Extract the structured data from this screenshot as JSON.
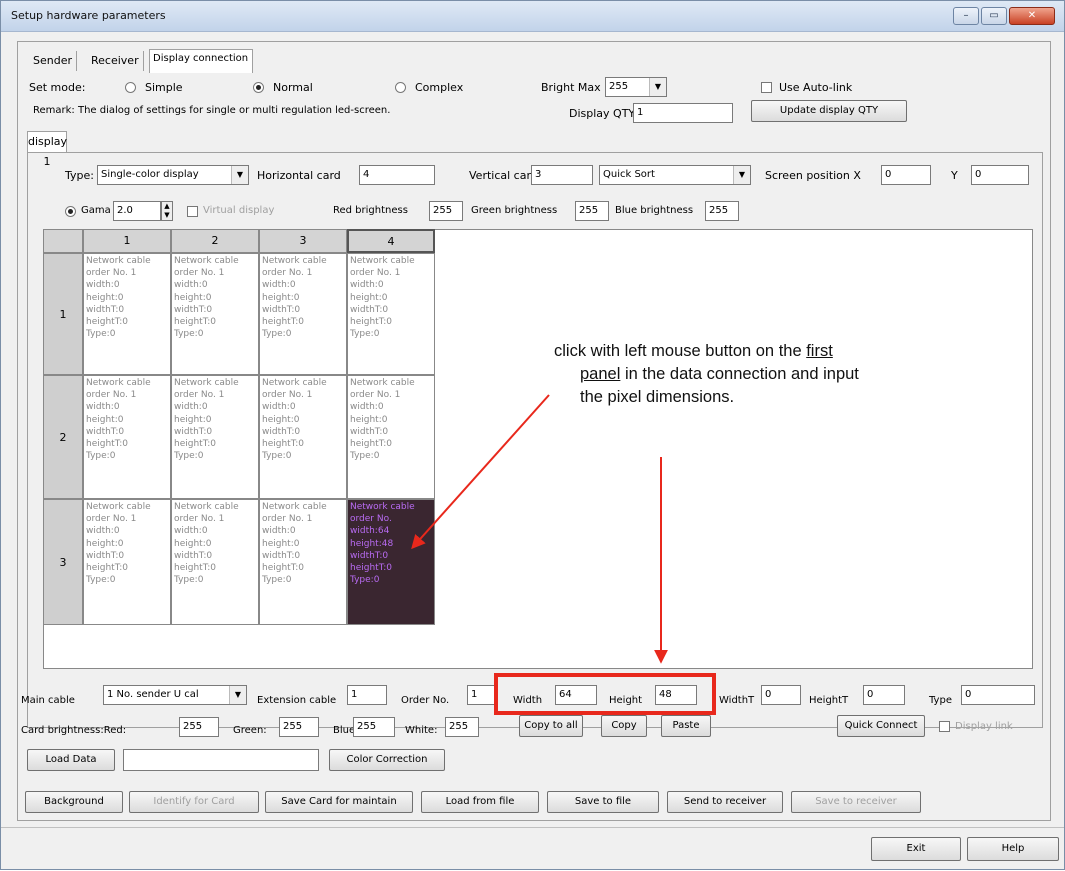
{
  "window": {
    "title": "Setup hardware parameters",
    "controls": [
      "–",
      "▭",
      "✕"
    ]
  },
  "tabs": [
    "Sender",
    "Receiver",
    "Display connection"
  ],
  "mode": {
    "label": "Set mode:",
    "options": [
      "Simple",
      "Normal",
      "Complex"
    ],
    "selected": "Normal",
    "bright_max_label": "Bright Max",
    "bright_max_value": "255",
    "use_autolink_label": "Use Auto-link",
    "remark": "Remark: The dialog of settings for single or multi  regulation led-screen.",
    "display_qty_label": "Display QTY:",
    "display_qty_value": "1",
    "update_btn": "Update display QTY"
  },
  "display_tab": "display 1",
  "config": {
    "type_label": "Type:",
    "type_value": "Single-color display",
    "hcard_label": "Horizontal card",
    "hcard_value": "4",
    "vcard_label": "Vertical card",
    "vcard_value": "3",
    "sort_value": "Quick Sort",
    "pos_x_label": "Screen position X",
    "pos_x_value": "0",
    "pos_y_label": "Y",
    "pos_y_value": "0",
    "gama_label": "Gama",
    "gama_value": "2.0",
    "virtual_label": "Virtual display",
    "red_label": "Red brightness",
    "red_value": "255",
    "green_label": "Green brightness",
    "green_value": "255",
    "blue_label": "Blue brightness",
    "blue_value": "255"
  },
  "grid": {
    "cols": [
      "1",
      "2",
      "3",
      "4"
    ],
    "rows": [
      "1",
      "2",
      "3"
    ],
    "cell_lines": [
      "Network cable",
      "order No. 1",
      "width:0",
      "height:0",
      "widthT:0",
      "heightT:0",
      "Type:0"
    ],
    "active_lines": [
      "Network cable",
      "order No.",
      "width:64",
      "height:48",
      "widthT:0",
      "heightT:0",
      "Type:0"
    ]
  },
  "annotation": {
    "line1": "click with left mouse button on the ",
    "first": "first",
    "panel": "panel",
    "line2": " in the data connection and input",
    "line3": "the pixel dimensions."
  },
  "bottom": {
    "main_cable_label": "Main cable",
    "main_cable_value": "1 No. sender U cal",
    "ext_cable_label": "Extension cable",
    "ext_cable_value": "1",
    "order_label": "Order No.",
    "order_value": "1",
    "width_label": "Width",
    "width_value": "64",
    "height_label": "Height",
    "height_value": "48",
    "widtht_label": "WidthT",
    "widtht_value": "0",
    "heightt_label": "HeightT",
    "heightt_value": "0",
    "type_label": "Type",
    "type_value": "0",
    "card_red_label": "Card brightness:Red:",
    "card_red_value": "255",
    "card_green_label": "Green:",
    "card_green_value": "255",
    "card_blue_label": "Blue:",
    "card_blue_value": "255",
    "card_white_label": "White:",
    "card_white_value": "255",
    "copy_all": "Copy to all",
    "copy": "Copy",
    "paste": "Paste",
    "quick_connect": "Quick Connect",
    "display_link": "Display link",
    "load_data": "Load Data",
    "color_correction": "Color Correction"
  },
  "actions": [
    "Background",
    "Identify for Card",
    "Save Card for maintain",
    "Load from file",
    "Save to file",
    "Send to receiver",
    "Save to receiver"
  ],
  "footer": {
    "exit": "Exit",
    "help": "Help"
  }
}
